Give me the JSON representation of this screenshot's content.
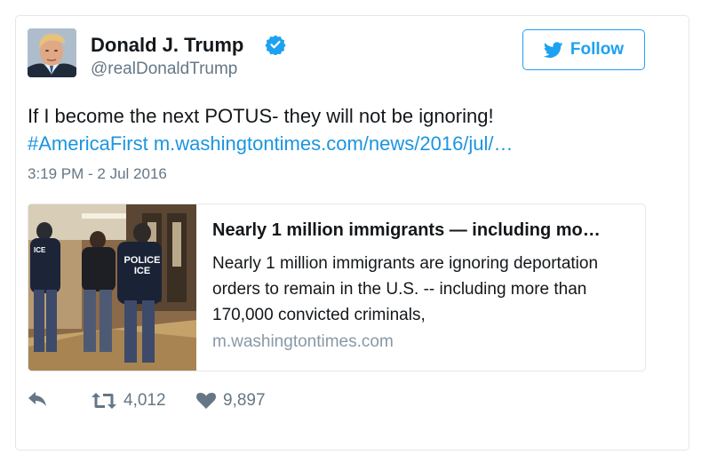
{
  "user": {
    "name": "Donald J. Trump",
    "handle": "@realDonaldTrump",
    "verified": true
  },
  "follow_button": {
    "label": "Follow",
    "icon": "twitter-bird-icon",
    "color": "#1da1f2"
  },
  "tweet": {
    "text": "If I become the next POTUS- they will not be ignoring!",
    "hashtag": "#AmericaFirst",
    "link": "m.washingtontimes.com/news/2016/jul/…",
    "timestamp": "3:19 PM - 2 Jul 2016"
  },
  "link_card": {
    "title": "Nearly 1 million immigrants — including mo…",
    "description": "Nearly 1 million immigrants are ignoring deportation orders to remain in the U.S. -- including more than 170,000 convicted criminals,",
    "domain": "m.washingtontimes.com",
    "image_labels": {
      "left_badge": "ICE",
      "vest_line1": "POLICE",
      "vest_line2": "ICE"
    }
  },
  "actions": {
    "reply_icon": "reply-icon",
    "retweet_icon": "retweet-icon",
    "retweet_count": "4,012",
    "like_icon": "heart-icon",
    "like_count": "9,897"
  },
  "colors": {
    "link": "#1b95e0",
    "muted": "#657786",
    "border": "#e1e8ed"
  }
}
